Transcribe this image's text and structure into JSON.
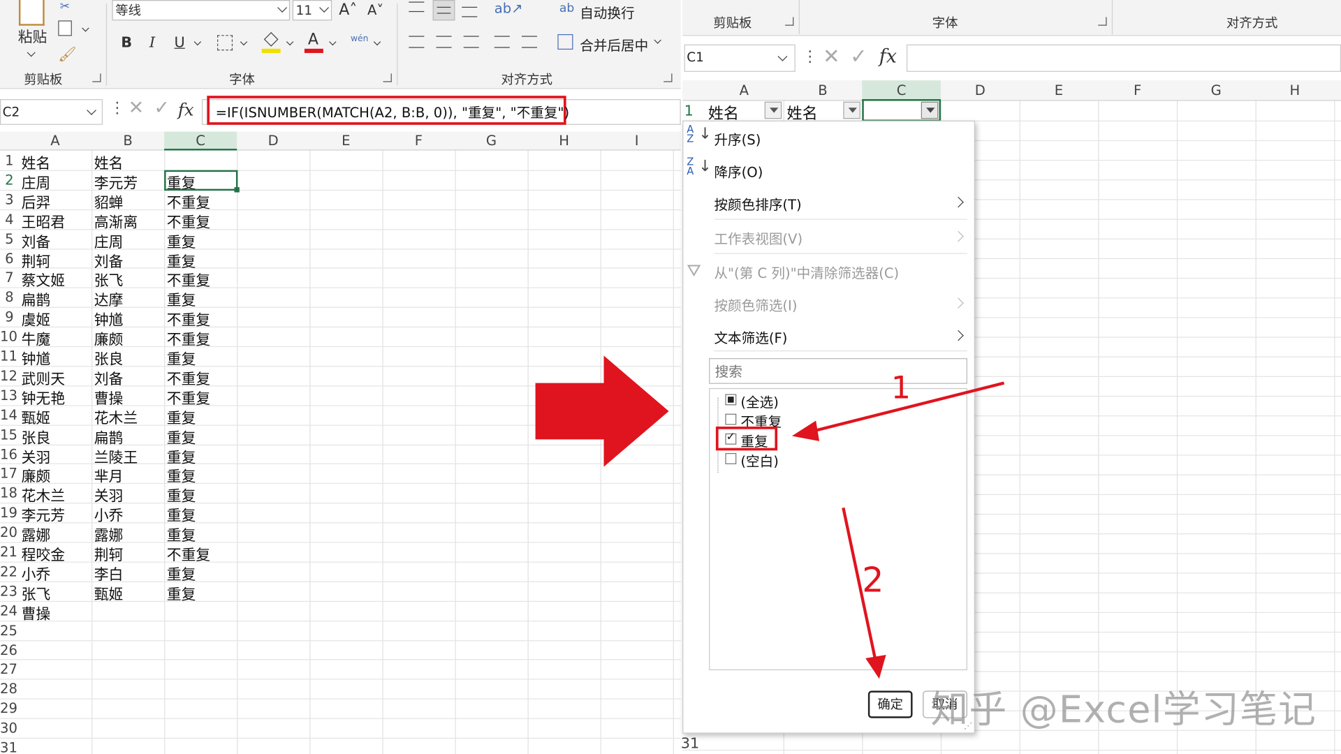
{
  "left_ribbon": {
    "paste_label": "粘贴",
    "font_name": "等线",
    "font_size": "11",
    "grow_font": "A˄",
    "shrink_font": "A˅",
    "bold": "B",
    "italic": "I",
    "underline": "U",
    "phonetic": "wén",
    "wrap_text": "自动换行",
    "merge_center": "合并后居中",
    "group_clipboard": "剪贴板",
    "group_font": "字体",
    "group_alignment": "对齐方式"
  },
  "left_formula": {
    "name_box": "C2",
    "formula": "=IF(ISNUMBER(MATCH(A2, B:B, 0)), \"重复\", \"不重复\")",
    "fx": "fx"
  },
  "left_sheet": {
    "columns": [
      "A",
      "B",
      "C",
      "D",
      "E",
      "F",
      "G",
      "H",
      "I"
    ],
    "row_numbers": [
      "1",
      "2",
      "3",
      "4",
      "5",
      "6",
      "7",
      "8",
      "9",
      "10",
      "11",
      "12",
      "13",
      "14",
      "15",
      "16",
      "17",
      "18",
      "19",
      "20",
      "21",
      "22",
      "23",
      "24",
      "25",
      "26",
      "27",
      "28",
      "29",
      "30",
      "31"
    ],
    "rows": [
      [
        "姓名",
        "姓名",
        ""
      ],
      [
        "庄周",
        "李元芳",
        "重复"
      ],
      [
        "后羿",
        "貂蝉",
        "不重复"
      ],
      [
        "王昭君",
        "高渐离",
        "不重复"
      ],
      [
        "刘备",
        "庄周",
        "重复"
      ],
      [
        "荆轲",
        "刘备",
        "重复"
      ],
      [
        "蔡文姬",
        "张飞",
        "不重复"
      ],
      [
        "扁鹊",
        "达摩",
        "重复"
      ],
      [
        "虞姬",
        "钟馗",
        "不重复"
      ],
      [
        "牛魔",
        "廉颇",
        "不重复"
      ],
      [
        "钟馗",
        "张良",
        "重复"
      ],
      [
        "武则天",
        "刘备",
        "不重复"
      ],
      [
        "钟无艳",
        "曹操",
        "不重复"
      ],
      [
        "甄姬",
        "花木兰",
        "重复"
      ],
      [
        "张良",
        "扁鹊",
        "重复"
      ],
      [
        "关羽",
        "兰陵王",
        "重复"
      ],
      [
        "廉颇",
        "芈月",
        "重复"
      ],
      [
        "花木兰",
        "关羽",
        "重复"
      ],
      [
        "李元芳",
        "小乔",
        "重复"
      ],
      [
        "露娜",
        "露娜",
        "重复"
      ],
      [
        "程咬金",
        "荆轲",
        "不重复"
      ],
      [
        "小乔",
        "李白",
        "重复"
      ],
      [
        "张飞",
        "甄姬",
        "重复"
      ],
      [
        "曹操",
        "",
        ""
      ]
    ]
  },
  "right_ribbon": {
    "group_clipboard": "剪贴板",
    "group_font": "字体",
    "group_alignment": "对齐方式"
  },
  "right_formula": {
    "name_box": "C1",
    "fx": "fx"
  },
  "right_sheet": {
    "columns": [
      "A",
      "B",
      "C",
      "D",
      "E",
      "F",
      "G",
      "H"
    ],
    "row1_num": "1",
    "row1_a": "姓名",
    "row1_b": "姓名",
    "row_last": "31"
  },
  "filter_menu": {
    "sort_asc": "升序(S)",
    "sort_desc": "降序(O)",
    "sort_by_color": "按颜色排序(T)",
    "sheet_view": "工作表视图(V)",
    "clear_filter": "从\"(第 C 列)\"中清除筛选器(C)",
    "filter_by_color": "按颜色筛选(I)",
    "text_filter": "文本筛选(F)",
    "search_placeholder": "搜索",
    "items": [
      "(全选)",
      "不重复",
      "重复",
      "(空白)"
    ],
    "ok": "确定",
    "cancel": "取消"
  },
  "annotations": {
    "step1": "1",
    "step2": "2"
  },
  "watermark": "知乎 @Excel学习笔记",
  "colors": {
    "accent_red": "#e0141e",
    "selection_green": "#217346",
    "ribbon_bg": "#f3f3f3"
  }
}
